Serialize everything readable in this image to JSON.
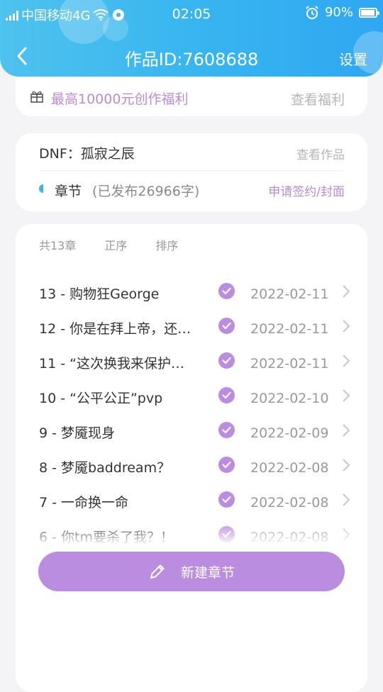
{
  "status_bar": {
    "carrier": "中国移动4G",
    "time": "02:05",
    "battery": "90%"
  },
  "nav": {
    "title": "作品ID:7608688",
    "settings": "设置"
  },
  "promo": {
    "text": "最高10000元创作福利",
    "link": "查看福利"
  },
  "work": {
    "title": "DNF：孤寂之辰",
    "view_link": "查看作品",
    "chapters_label": "章节",
    "chapters_count": "(已发布26966字)",
    "apply_link": "申请签约/封面"
  },
  "list_header": {
    "total": "共13章",
    "asc": "正序",
    "sort": "排序"
  },
  "chapters": [
    {
      "title": "13 - 购物狂George",
      "date": "2022-02-11"
    },
    {
      "title": "12 - 你是在拜上帝，还…",
      "date": "2022-02-11"
    },
    {
      "title": "11 - “这次换我来保护…",
      "date": "2022-02-11"
    },
    {
      "title": "10 - “公平公正”pvp",
      "date": "2022-02-10"
    },
    {
      "title": "9 - 梦魇现身",
      "date": "2022-02-09"
    },
    {
      "title": "8 - 梦魇baddream？",
      "date": "2022-02-08"
    },
    {
      "title": "7 - 一命换一命",
      "date": "2022-02-08"
    },
    {
      "title": "6 - 你tm要杀了我？！",
      "date": "2022-02-08"
    }
  ],
  "new_chapter_button": "新建章节",
  "colors": {
    "header_blue": "#38b6f0",
    "accent_purple": "#bb8de0",
    "link_purple": "#b98ad9"
  }
}
